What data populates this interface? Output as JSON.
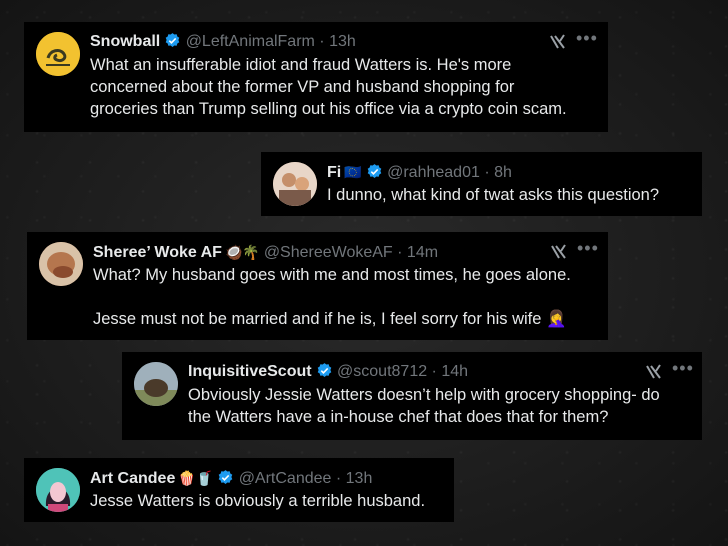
{
  "tweets": [
    {
      "name": "Snowball",
      "handle": "@LeftAnimalFarm",
      "time": "13h",
      "text": "What an insufferable idiot and fraud Watters is. He's more\nconcerned about the former VP and husband shopping for\ngroceries than Trump selling out his office via a crypto coin scam.",
      "emojis": ""
    },
    {
      "name": "Fi",
      "handle": "@rahhead01",
      "time": "8h",
      "text": "I dunno, what kind of twat asks this question?",
      "emojis": "🇪🇺"
    },
    {
      "name": "Sheree’ Woke AF",
      "handle": "@ShereeWokeAF",
      "time": "14m",
      "text": "What? My husband goes with me and most times, he goes alone.\n\nJesse must not be married and if he is, I feel sorry for his wife 🤦‍♀️",
      "emojis": "🥥🌴"
    },
    {
      "name": "InquisitiveScout",
      "handle": "@scout8712",
      "time": "14h",
      "text": "Obviously Jessie Watters doesn’t help with grocery shopping- do\nthe Watters  have a in-house chef that does that for  them?",
      "emojis": ""
    },
    {
      "name": "Art Candee",
      "handle": "@ArtCandee",
      "time": "13h",
      "text": "Jesse Watters is obviously a terrible husband.",
      "emojis": "🍿🥤"
    }
  ],
  "separator": " · ",
  "icons": {
    "verified": "verified-badge-icon",
    "grok": "grok-icon",
    "more": "more-options-icon"
  },
  "colors": {
    "verified": "#1d9bf0",
    "text": "#e7e9ea",
    "secondary": "#71767b",
    "card": "#000000"
  }
}
